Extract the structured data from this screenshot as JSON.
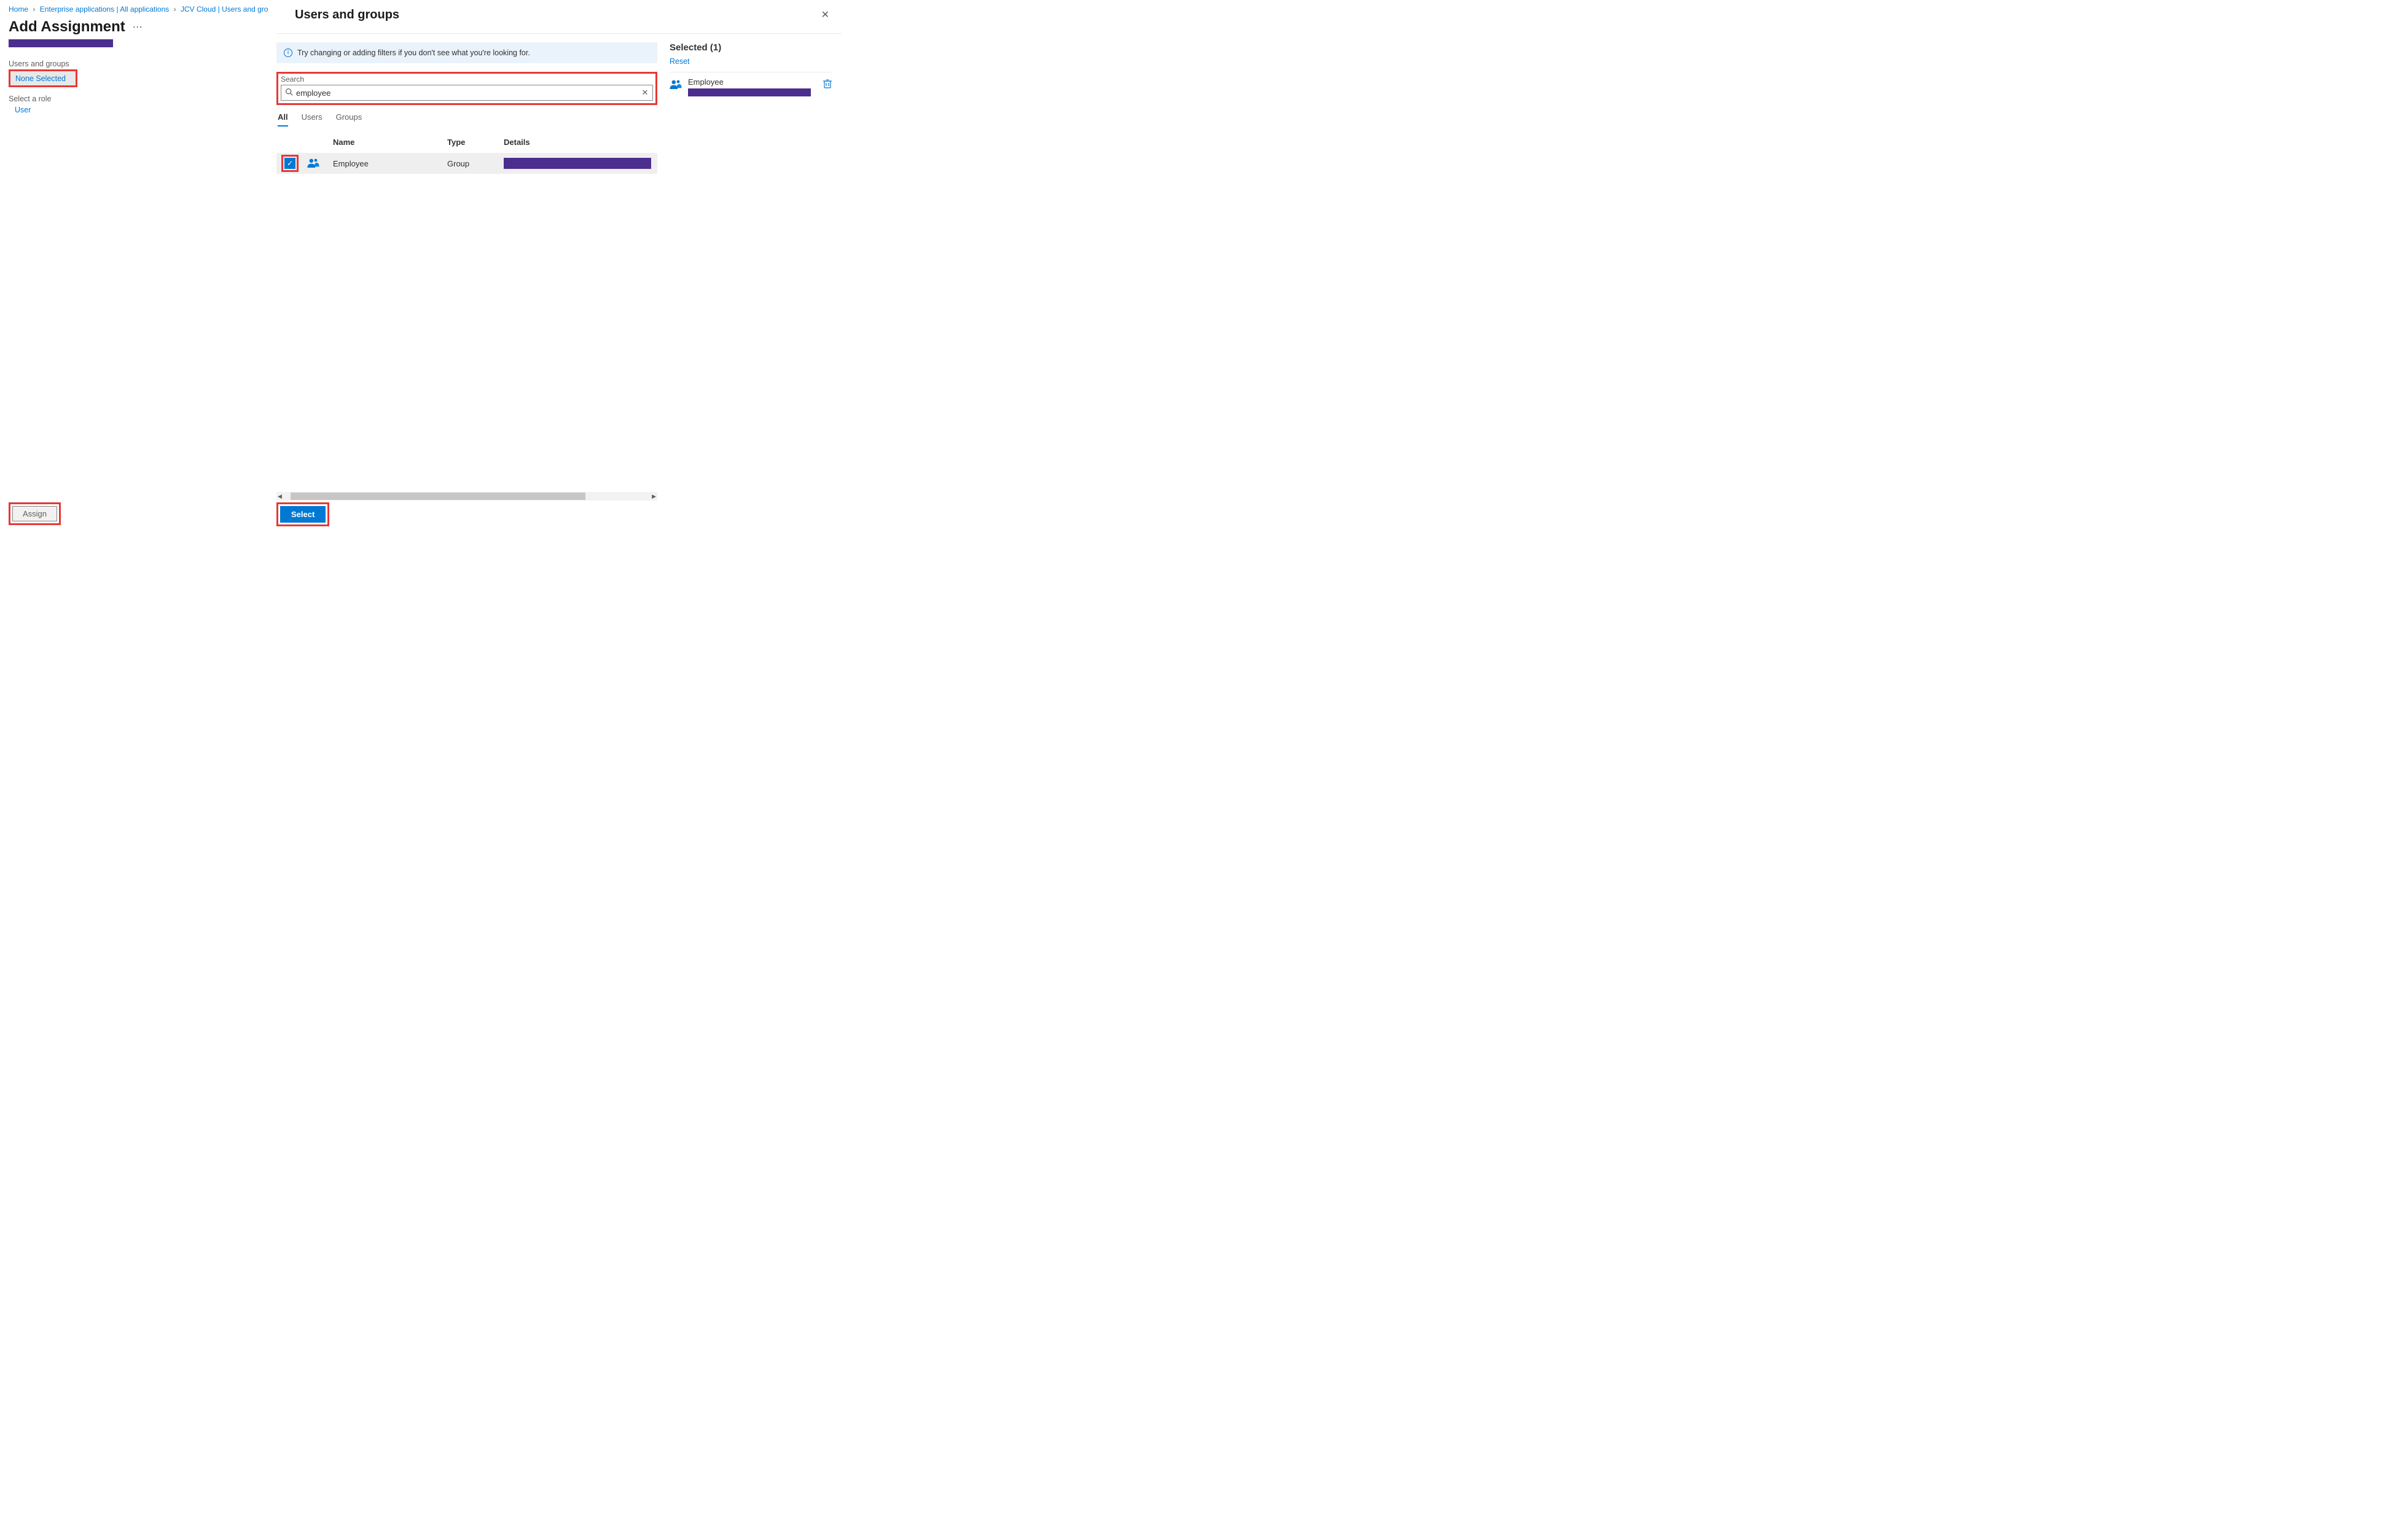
{
  "breadcrumb": {
    "items": [
      "Home",
      "Enterprise applications | All applications",
      "JCV Cloud | Users and grou"
    ]
  },
  "page": {
    "title": "Add Assignment",
    "users_groups_label": "Users and groups",
    "none_selected": "None Selected",
    "select_role_label": "Select a role",
    "role_value": "User",
    "assign_button": "Assign"
  },
  "panel": {
    "title": "Users and groups",
    "info_text": "Try changing or adding filters if you don't see what you're looking for.",
    "search_label": "Search",
    "search_value": "employee",
    "tabs": {
      "all": "All",
      "users": "Users",
      "groups": "Groups"
    },
    "columns": {
      "name": "Name",
      "type": "Type",
      "details": "Details"
    },
    "rows": [
      {
        "name": "Employee",
        "type": "Group"
      }
    ],
    "select_button": "Select"
  },
  "selected": {
    "title": "Selected (1)",
    "reset": "Reset",
    "items": [
      {
        "name": "Employee"
      }
    ]
  }
}
